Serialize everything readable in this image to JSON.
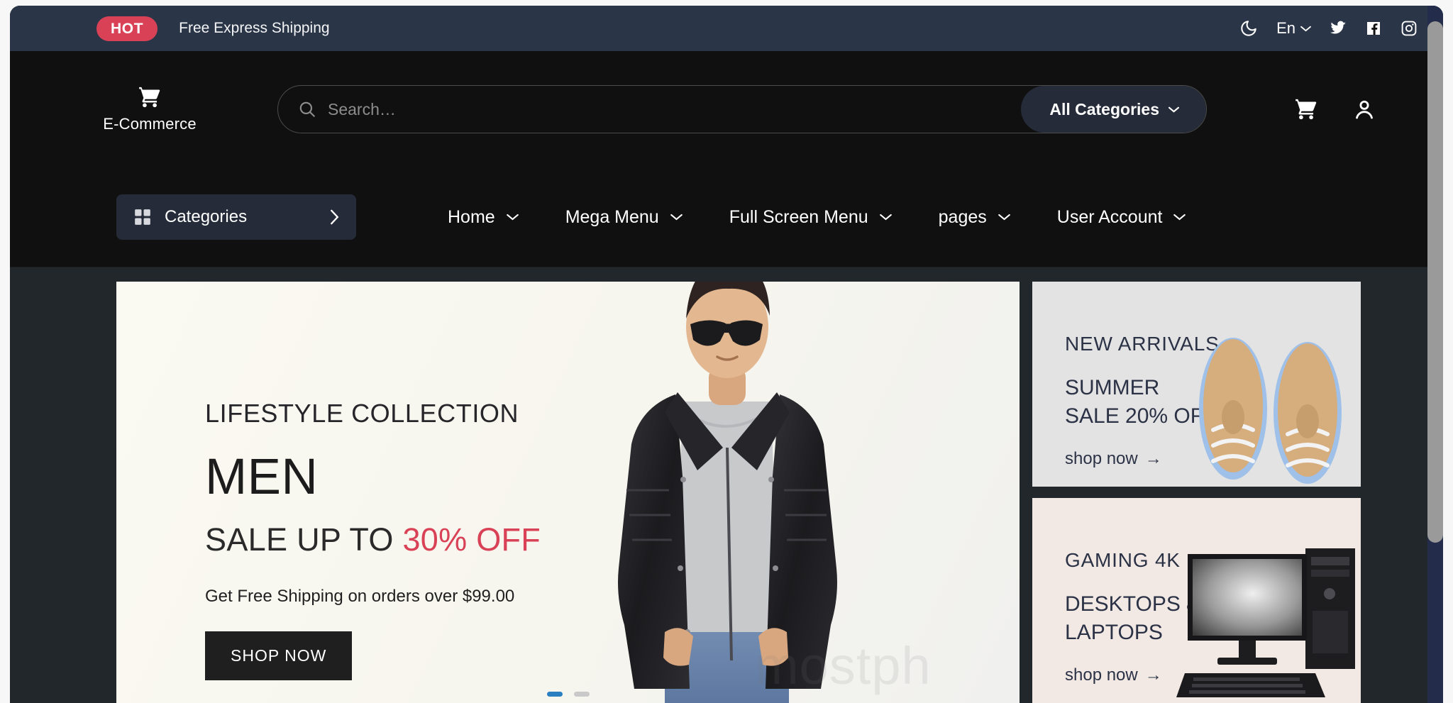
{
  "topbar": {
    "badge": "HOT",
    "message": "Free Express Shipping",
    "dark_mode_icon": "moon-icon",
    "language": "En",
    "socials": [
      "twitter-icon",
      "facebook-icon",
      "instagram-icon"
    ]
  },
  "header": {
    "logo_text": "E-Commerce",
    "logo_icon": "shopping-cart-icon",
    "search_placeholder": "Search…",
    "search_value": "",
    "search_icon": "search-icon",
    "all_categories_label": "All Categories",
    "cart_icon": "shopping-cart-icon",
    "account_icon": "user-icon"
  },
  "nav": {
    "categories_label": "Categories",
    "categories_icon": "grid-icon",
    "items": [
      {
        "label": "Home",
        "has_caret": true
      },
      {
        "label": "Mega Menu",
        "has_caret": true
      },
      {
        "label": "Full Screen Menu",
        "has_caret": true
      },
      {
        "label": "pages",
        "has_caret": true
      },
      {
        "label": "User Account",
        "has_caret": true
      }
    ]
  },
  "hero": {
    "kicker": "LIFESTYLE COLLECTION",
    "title": "MEN",
    "sale_prefix": "SALE UP TO ",
    "sale_highlight": "30% OFF",
    "subtitle": "Get Free Shipping on orders over $99.00",
    "cta": "SHOP NOW",
    "watermark": "mostph",
    "slide_count": 2,
    "active_slide": 1
  },
  "promos": [
    {
      "kicker": "NEW ARRIVALS",
      "line1": "SUMMER",
      "line2": "SALE 20% OFF",
      "link": "shop now",
      "arrow": "→",
      "art": "sneakers-image",
      "bg": "#e3e3e3"
    },
    {
      "kicker": "GAMING 4K",
      "line1": "DESKTOPS &",
      "line2": "LAPTOPS",
      "link": "shop now",
      "arrow": "→",
      "art": "desktop-computer-image",
      "bg": "#f2e9e4"
    }
  ],
  "colors": {
    "topbar_bg": "#2b3548",
    "badge_bg": "#d94256",
    "header_bg": "#101010",
    "accent_red": "#d94256",
    "chip_bg": "#252b38",
    "page_bg": "#22272b"
  }
}
